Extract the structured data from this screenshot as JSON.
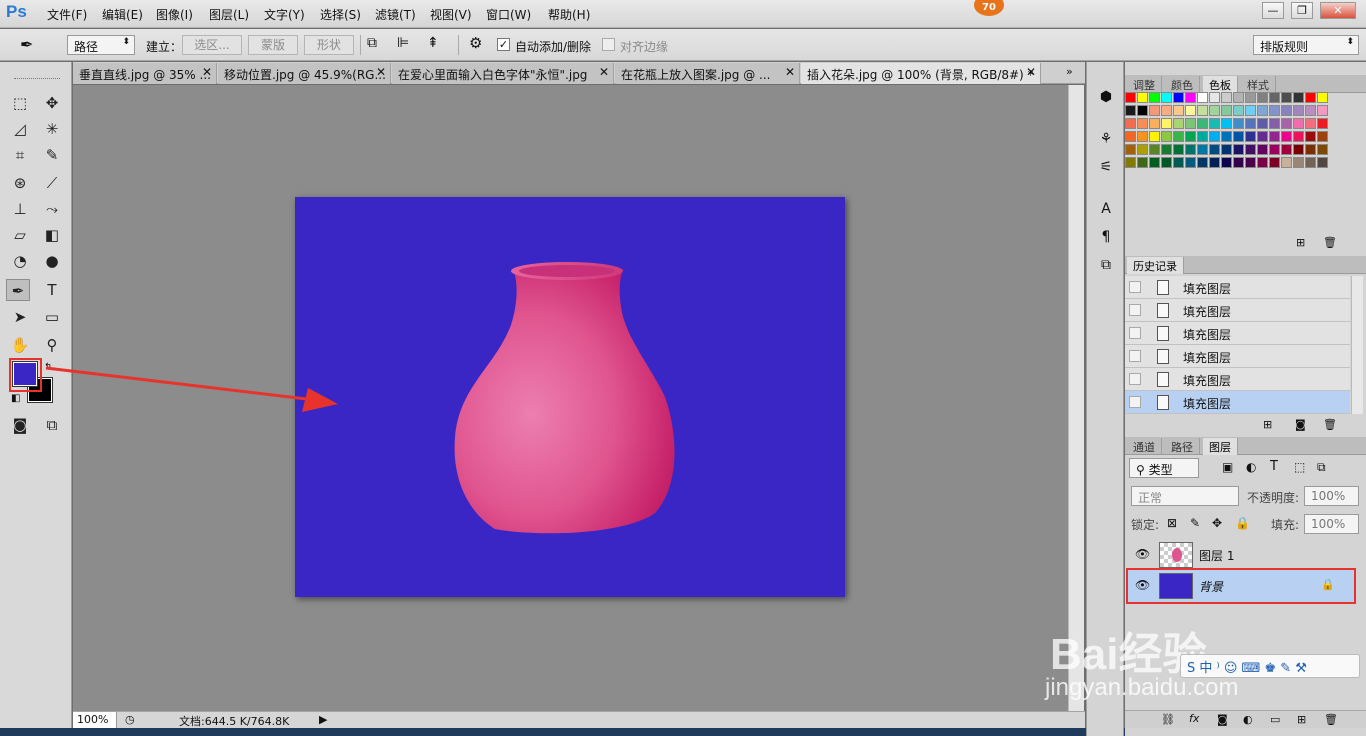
{
  "app": {
    "logo": "Ps",
    "notification_count": "70"
  },
  "menu": [
    {
      "label": "文件(F)"
    },
    {
      "label": "编辑(E)"
    },
    {
      "label": "图像(I)"
    },
    {
      "label": "图层(L)"
    },
    {
      "label": "文字(Y)"
    },
    {
      "label": "选择(S)"
    },
    {
      "label": "滤镜(T)"
    },
    {
      "label": "视图(V)"
    },
    {
      "label": "窗口(W)"
    },
    {
      "label": "帮助(H)"
    }
  ],
  "window_buttons": {
    "minimize": "—",
    "restore": "❐",
    "close": "✕"
  },
  "options": {
    "mode_select": "路径",
    "build_label": "建立：",
    "btn_selection": "选区...",
    "btn_mask": "蒙版",
    "btn_shape": "形状",
    "auto_add_delete": "自动添加/删除",
    "align_edges": "对齐边缘",
    "workspace": "排版规则"
  },
  "tabs": [
    {
      "label": "垂直直线.jpg @ 35% ..."
    },
    {
      "label": "移动位置.jpg @ 45.9%(RG..."
    },
    {
      "label": "在爱心里面输入白色字体\"永恒\".jpg"
    },
    {
      "label": "在花瓶上放入图案.jpg @ ..."
    },
    {
      "label": "插入花朵.jpg @ 100% (背景, RGB/8#) *"
    }
  ],
  "status": {
    "zoom": "100%",
    "doc_size": "文档:644.5 K/764.8K"
  },
  "colors": {
    "foreground": "#3a26c5",
    "background": "#000000",
    "doc_fill": "#3a26c5",
    "vase": "#e0558f"
  },
  "panels": {
    "top_tabs": [
      {
        "label": "调整"
      },
      {
        "label": "颜色"
      },
      {
        "label": "色板"
      },
      {
        "label": "样式"
      }
    ],
    "history_tab": "历史记录",
    "history": [
      {
        "label": "填充图层"
      },
      {
        "label": "填充图层"
      },
      {
        "label": "填充图层"
      },
      {
        "label": "填充图层"
      },
      {
        "label": "填充图层"
      },
      {
        "label": "填充图层"
      }
    ],
    "layer_tabs": [
      {
        "label": "通道"
      },
      {
        "label": "路径"
      },
      {
        "label": "图层"
      }
    ],
    "filter_kind": "类型",
    "blend_mode": "正常",
    "opacity_label": "不透明度:",
    "opacity": "100%",
    "lock_label": "锁定:",
    "fill_label": "填充:",
    "fill": "100%",
    "layers": [
      {
        "name": "图层 1"
      },
      {
        "name": "背景"
      }
    ]
  },
  "watermark": {
    "brand": "Bai经验",
    "url": "jingyan.baidu.com"
  }
}
